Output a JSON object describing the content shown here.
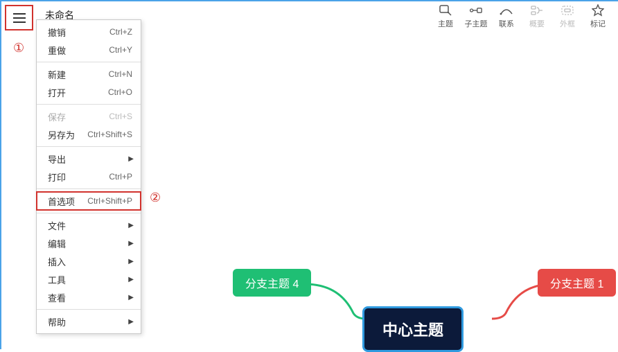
{
  "header": {
    "title_fragment": "未命名"
  },
  "toolbar": {
    "items": [
      {
        "id": "topic",
        "label": "主题"
      },
      {
        "id": "subtopic",
        "label": "子主题"
      },
      {
        "id": "relation",
        "label": "联系"
      },
      {
        "id": "summary",
        "label": "概要"
      },
      {
        "id": "boundary",
        "label": "外框"
      },
      {
        "id": "marker",
        "label": "标记"
      }
    ]
  },
  "menu": {
    "groups": [
      [
        {
          "id": "undo",
          "label": "撤销",
          "shortcut": "Ctrl+Z"
        },
        {
          "id": "redo",
          "label": "重做",
          "shortcut": "Ctrl+Y"
        }
      ],
      [
        {
          "id": "new",
          "label": "新建",
          "shortcut": "Ctrl+N"
        },
        {
          "id": "open",
          "label": "打开",
          "shortcut": "Ctrl+O"
        }
      ],
      [
        {
          "id": "save",
          "label": "保存",
          "shortcut": "Ctrl+S",
          "disabled": true
        },
        {
          "id": "saveas",
          "label": "另存为",
          "shortcut": "Ctrl+Shift+S"
        }
      ],
      [
        {
          "id": "export",
          "label": "导出",
          "submenu": true
        },
        {
          "id": "print",
          "label": "打印",
          "shortcut": "Ctrl+P"
        }
      ],
      [
        {
          "id": "prefs",
          "label": "首选项",
          "shortcut": "Ctrl+Shift+P",
          "highlight": true
        }
      ],
      [
        {
          "id": "file",
          "label": "文件",
          "submenu": true
        },
        {
          "id": "edit",
          "label": "编辑",
          "submenu": true
        },
        {
          "id": "insert",
          "label": "插入",
          "submenu": true
        },
        {
          "id": "tools",
          "label": "工具",
          "submenu": true
        },
        {
          "id": "view",
          "label": "查看",
          "submenu": true
        }
      ],
      [
        {
          "id": "help",
          "label": "帮助",
          "submenu": true
        }
      ]
    ]
  },
  "mindmap": {
    "center": "中心主题",
    "branch_left": "分支主题 4",
    "branch_right": "分支主题 1"
  },
  "annotations": {
    "one": "①",
    "two": "②"
  }
}
